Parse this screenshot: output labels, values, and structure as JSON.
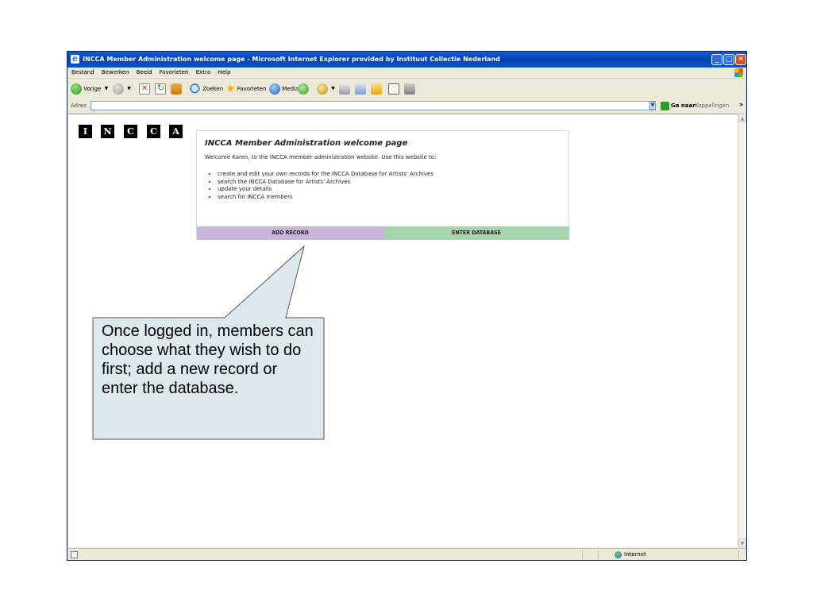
{
  "window": {
    "title": "INCCA Member Administration welcome page - Microsoft Internet Explorer provided by Instituut Collectie Nederland"
  },
  "menubar": {
    "items": [
      "Bestand",
      "Bewerken",
      "Beeld",
      "Favorieten",
      "Extra",
      "Help"
    ]
  },
  "toolbar": {
    "back_label": "Vorige",
    "search_label": "Zoeken",
    "favorites_label": "Favorieten",
    "media_label": "Media"
  },
  "addressbar": {
    "label": "Adres",
    "value": "",
    "go_label": "Ga naar",
    "links_label": "Koppelingen"
  },
  "logo": {
    "letters": [
      "I",
      "N",
      "C",
      "C",
      "A"
    ]
  },
  "page": {
    "title": "INCCA Member Administration welcome page",
    "intro": "Welcome Karen, to the INCCA member administration website. Use this website to:",
    "bullets": [
      "create and edit your own records for the INCCA Database for Artists' Archives",
      "search the INCCA Database for Artists' Archives",
      "update your details",
      "search for INCCA members"
    ],
    "add_record_label": "ADD RECORD",
    "enter_database_label": "ENTER DATABASE"
  },
  "statusbar": {
    "zone": "Internet"
  },
  "callout": {
    "text": "Once logged in, members can choose what they wish to do first; add a new record or enter the database."
  },
  "colors": {
    "titlebar": "#0842b0",
    "add_record_bg": "#c8b4d8",
    "enter_database_bg": "#a6d4ac",
    "callout_bg": "#dde9ec"
  }
}
